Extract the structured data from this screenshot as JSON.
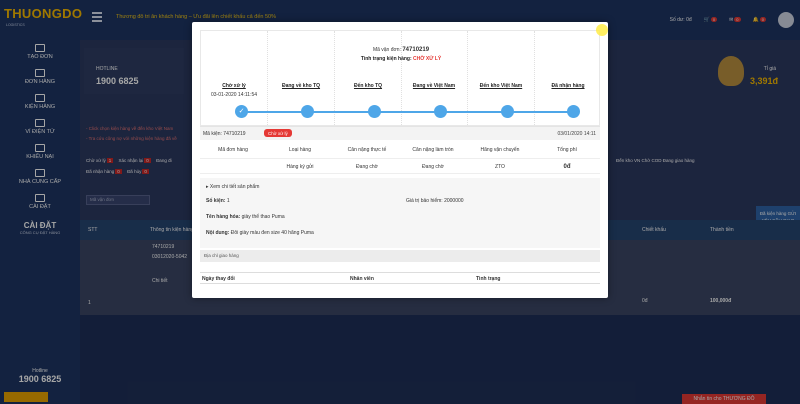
{
  "topbar": {
    "logo_text": "THUONGDO",
    "logo_sub": "LOGISTICS",
    "promo": "Thương đô tri ân khách hàng – Ưu đãi lên chiết khấu cả đến 50%",
    "balance_label": "Số dư:",
    "balance_value": "0đ",
    "cart_badge": "0",
    "mail_badge": "0",
    "bell_badge": "0"
  },
  "sidebar": {
    "items": [
      {
        "label": "TẠO ĐƠN"
      },
      {
        "label": "ĐƠN HÀNG"
      },
      {
        "label": "KIỆN HÀNG"
      },
      {
        "label": "VÍ ĐIỆN TỬ"
      },
      {
        "label": "KHIẾU NẠI"
      },
      {
        "label": "NHÀ CUNG CẤP"
      },
      {
        "label": "CÀI ĐẶT"
      }
    ],
    "settings_title": "CÀI ĐẶT",
    "settings_sub": "CÔNG CỤ ĐẶT HÀNG",
    "hotline_label": "Hotline",
    "hotline_number": "1900 6825"
  },
  "main": {
    "hotline_label": "HOTLINE",
    "hotline_number": "1900 6825",
    "wallet_label": "Tỉ giá",
    "wallet_value": "3,391đ",
    "info_line_1": "- Click chọn kiện hàng về đến kho Việt Nam",
    "info_line_2": "- Tra cứu công nợ với những kiện hàng đã về",
    "filter_line_1": "Chờ xử lý",
    "filter_badge_1": "1",
    "filter_line_2": "Xác nhận lại",
    "filter_badge_2": "0",
    "filter_line_3": "Đang đi",
    "filter_row2_a": "Đã nhận hàng",
    "filter_row2_a_badge": "0",
    "filter_row2_b": "Đã hủy",
    "filter_row2_b_badge": "0",
    "filter_right": "Đến kho VN  Chờ COD  Đang giao hàng",
    "search_placeholder": "Mã vận đơn",
    "col_stt": "STT",
    "col_info": "Thông tin kiện hàng",
    "col_discount": "Chiết khấu",
    "col_total": "Thành tiền",
    "right_pill": "Đã kiện hàng GỬI YÊU CẦU GIAO HÀNG",
    "row_index": "1",
    "row_code": "74710219",
    "row_date": "03012020-5042",
    "row_detail": "Chi tiết",
    "row_discount": "0đ",
    "row_total": "100,000đ",
    "chat_label": "Nhắn tin cho THƯƠNG ĐÔ"
  },
  "modal": {
    "tracking_code_label": "Mã vận đơn:",
    "tracking_code": "74710219",
    "status_label": "Tình trạng kiện hàng:",
    "status_value": "CHỜ XỬ LÝ",
    "steps": [
      {
        "label": "Chờ xử lý",
        "date": "03-01-2020 14:11:54"
      },
      {
        "label": "Đang về kho TQ",
        "date": ""
      },
      {
        "label": "Đến kho TQ",
        "date": ""
      },
      {
        "label": "Đang về Việt Nam",
        "date": ""
      },
      {
        "label": "Đến kho Việt Nam",
        "date": ""
      },
      {
        "label": "Đã nhận hàng",
        "date": ""
      }
    ],
    "step_done_count": 1,
    "order_label": "Mã kiện:",
    "order_code": "74710219",
    "order_status": "Chờ xử lý",
    "order_date": "03/01/2020 14:11",
    "table_headers": [
      "Mã đơn hàng",
      "Loại hàng",
      "Cân nặng thực tế",
      "Cân nặng làm tròn",
      "Hãng vận chuyển",
      "Tổng phí"
    ],
    "table_row": [
      "",
      "Hàng ký gửi",
      "Đang chờ",
      "Đang chờ",
      "ZTO",
      "0đ"
    ],
    "expand_label": "▸ Xem chi tiết sản phẩm",
    "qty_label": "Số kiện:",
    "qty_value": "1",
    "insurance_label": "Giá trị bảo hiểm:",
    "insurance_value": "2000000",
    "product_label": "Tên hàng hóa:",
    "product_value": "giày thể thao Puma",
    "content_label": "Nội dung:",
    "content_value": "Đôi giày màu đen size 40 hãng Puma",
    "address_label": "Địa chỉ giao hàng",
    "history_headers": [
      "Ngày thay đổi",
      "Nhân viên",
      "Tình trạng"
    ]
  },
  "colors": {
    "navy": "#1e3563",
    "accent_blue": "#4ea6e8",
    "status_red": "#e53935",
    "gold": "#f5b800"
  }
}
